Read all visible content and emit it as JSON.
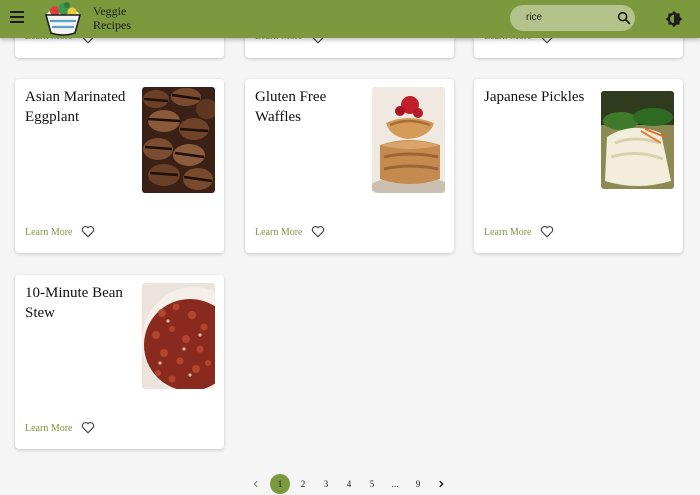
{
  "header": {
    "brand_line1": "Veggie",
    "brand_line2": "Recipes",
    "search_value": "rice",
    "accent_color": "#7c9a3d"
  },
  "top_row": {
    "learn_more": [
      "Learn More",
      "Learn More",
      "Learn More"
    ]
  },
  "cards": [
    {
      "title": "Asian Marinated Eggplant",
      "learn_more": "Learn More",
      "photo": "grilled-eggplant-photo"
    },
    {
      "title": "Gluten Free Waffles",
      "learn_more": "Learn More",
      "photo": "waffles-photo"
    },
    {
      "title": "Japanese Pickles",
      "learn_more": "Learn More",
      "photo": "pickles-photo"
    },
    {
      "title": "10-Minute Bean Stew",
      "learn_more": "Learn More",
      "photo": "bean-stew-photo"
    }
  ],
  "pagination": {
    "prev_icon": "chevron-left-icon",
    "pages": [
      "1",
      "2",
      "3",
      "4",
      "5",
      "...",
      "9"
    ],
    "current": "1",
    "next_icon": "chevron-right-icon"
  }
}
